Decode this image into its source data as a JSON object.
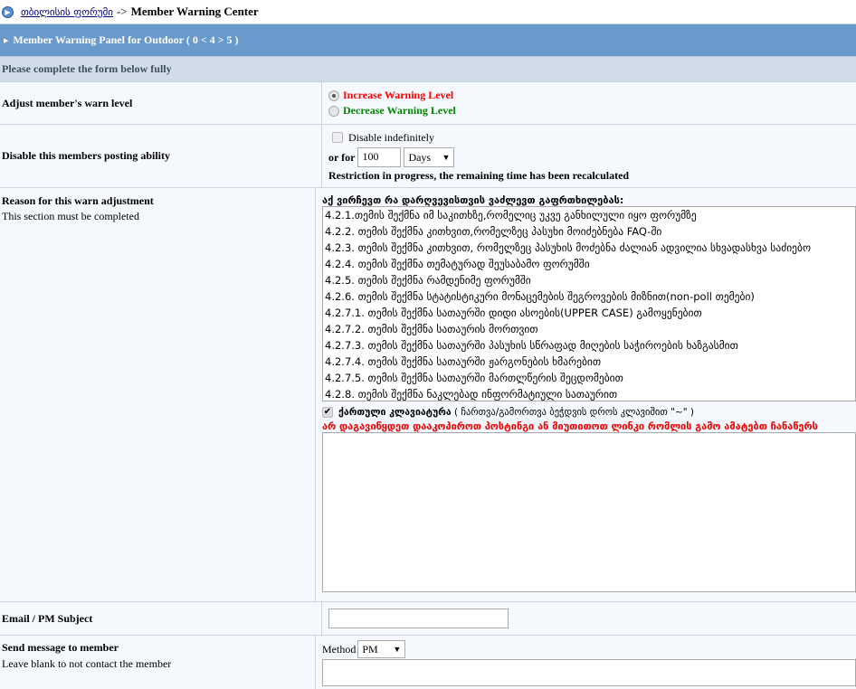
{
  "nav": {
    "home": "თბილისის ფორუმი",
    "separator": "->",
    "current": "Member Warning Center"
  },
  "panel": {
    "title": "Member Warning Panel for Outdoor ( 0 < 4 > 5 )",
    "subtitle": "Please complete the form below fully"
  },
  "warn": {
    "label": "Adjust member's warn level",
    "increase": "Increase Warning Level",
    "decrease": "Decrease Warning Level",
    "increase_color": "#ff0000",
    "decrease_color": "#008000",
    "selected": "increase"
  },
  "posting": {
    "label": "Disable this members posting ability",
    "indef": "Disable indefinitely",
    "or_for": "or for",
    "value": "100",
    "unit": "Days",
    "note": "Restriction in progress, the remaining time has been recalculated"
  },
  "reason": {
    "label": "Reason for this warn adjustment",
    "hint": "This section must be completed",
    "list_title": "აქ ვირჩევთ რა დარღვევისთვის ვაძლევთ გაფრთხილებას:",
    "options": [
      "4.2.1.თემის შექმნა იმ საკითხზე,რომელიც უკვე განხილული იყო ფორუმზე",
      "4.2.2. თემის შექმნა კითხვით,რომელზეც პასუხი მოიძებნება FAQ-ში",
      "4.2.3. თემის შექმნა კითხვით, რომელზეც პასუხის მოძებნა ძალიან ადვილია სხვადასხვა საძიებო",
      "4.2.4. თემის შექმნა თემატურად შეუსაბამო ფორუმში",
      "4.2.5. თემის შექმნა რამდენიმე ფორუმში",
      "4.2.6. თემის შექმნა სტატისტიკური მონაცემების შეგროვების მიზნით(non-poll თემები)",
      "4.2.7.1. თემის შექმნა სათაურში დიდი ასოების(UPPER CASE) გამოყენებით",
      "4.2.7.2. თემის შექმნა სათაურის მორთვით",
      "4.2.7.3. თემის შექმნა სათაურში პასუხის სწრაფად მიღების საჭიროების ხაზგასმით",
      "4.2.7.4. თემის შექმნა სათაურში ჟარგონების ხმარებით",
      "4.2.7.5. თემის შექმნა სათაურში მართლწერის შეცდომებით",
      "4.2.8. თემის შექმნა ნაკლებად ინფორმატიული სათაურით"
    ],
    "keyboard": "ქართული კლავიატურა",
    "keyboard_hint": "( ჩართვა/გამორთვა ბეჭდვის დროს კლავიშით \"~\" )",
    "warning": "არ დაგავიწყდეთ დააკოპიროთ პოსტინგი ან მიუთითოთ ლინკი რომლის გამო ამატებთ ჩანაწერს"
  },
  "subject": {
    "label": "Email / PM Subject",
    "value": ""
  },
  "message": {
    "label": "Send message to member",
    "hint": "Leave blank to not contact the member",
    "method_label": "Method",
    "method": "PM"
  }
}
